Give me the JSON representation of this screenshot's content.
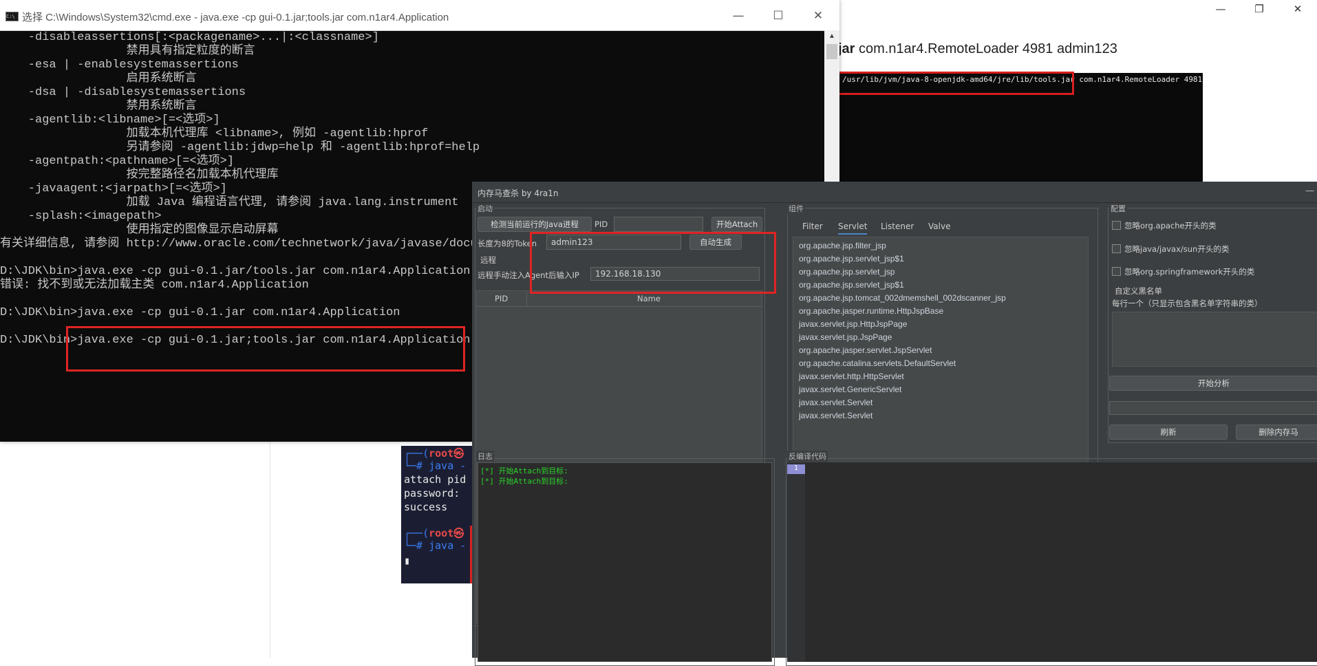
{
  "background_article": {
    "heading_bold": "jar",
    "heading_rest": " com.n1ar4.RemoteLoader 4981 admin123",
    "terminal_text": "/usr/lib/jvm/java-8-openjdk-amd64/jre/lib/tools.jar com.n1ar4.RemoteLoader 4981",
    "window_controls": [
      "—",
      "❐",
      "✕"
    ]
  },
  "kali_terminal": {
    "lines": [
      {
        "cls": "blue",
        "text": "┌──(",
        "extra": "root㉿"
      },
      {
        "cls": "blue",
        "text": "└─# java -"
      },
      {
        "cls": "white",
        "text": "attach pid"
      },
      {
        "cls": "white",
        "text": "password:"
      },
      {
        "cls": "white",
        "text": "success"
      },
      {
        "cls": "blue",
        "text": "┌──(",
        "extra": "root㉿"
      },
      {
        "cls": "blue",
        "text": "└─# java -"
      },
      {
        "cls": "white",
        "text": "▮"
      }
    ]
  },
  "cmd_window": {
    "icon_text": "C:\\",
    "title": "选择 C:\\Windows\\System32\\cmd.exe - java.exe  -cp gui-0.1.jar;tools.jar com.n1ar4.Application",
    "controls": [
      "—",
      "☐",
      "✕"
    ],
    "lines": [
      "    -disableassertions[:<packagename>...|:<classname>]",
      "                  禁用具有指定粒度的断言",
      "    -esa | -enablesystemassertions",
      "                  启用系统断言",
      "    -dsa | -disablesystemassertions",
      "                  禁用系统断言",
      "    -agentlib:<libname>[=<选项>]",
      "                  加载本机代理库 <libname>, 例如 -agentlib:hprof",
      "                  另请参阅 -agentlib:jdwp=help 和 -agentlib:hprof=help",
      "    -agentpath:<pathname>[=<选项>]",
      "                  按完整路径名加载本机代理库",
      "    -javaagent:<jarpath>[=<选项>]",
      "                  加载 Java 编程语言代理, 请参阅 java.lang.instrument",
      "    -splash:<imagepath>",
      "                  使用指定的图像显示启动屏幕",
      "有关详细信息, 请参阅 http://www.oracle.com/technetwork/java/javase/documentation/index.html。",
      "",
      "D:\\JDK\\bin>java.exe -cp gui-0.1.jar/tools.jar com.n1ar4.Application",
      "错误: 找不到或无法加载主类 com.n1ar4.Application",
      "",
      "D:\\JDK\\bin>java.exe -cp gui-0.1.jar com.n1ar4.Application",
      "",
      "D:\\JDK\\bin>java.exe -cp gui-0.1.jar;tools.jar com.n1ar4.Application"
    ]
  },
  "tool": {
    "title": "内存马查杀 by 4ra1n",
    "minimize": "—",
    "start_section": {
      "title": "启动",
      "detect_button": "检测当前运行的Java进程",
      "pid_label": "PID",
      "pid_value": "",
      "attach_button": "开始Attach",
      "token_label": "长度为8的Token",
      "token_value": "admin123",
      "auto_button": "自动生成",
      "remote_title": "远程",
      "remote_label": "远程手动注入Agent后输入IP",
      "remote_ip": "192.168.18.130"
    },
    "process_table": {
      "headers": [
        "PID",
        "Name"
      ]
    },
    "components": {
      "title": "组件",
      "tabs": [
        "Filter",
        "Servlet",
        "Listener",
        "Valve"
      ],
      "selected_tab": "Servlet",
      "classes": [
        "org.apache.jsp.filter_jsp",
        "org.apache.jsp.servlet_jsp$1",
        "org.apache.jsp.servlet_jsp",
        "org.apache.jsp.servlet_jsp$1",
        "org.apache.jsp.tomcat_002dmemshell_002dscanner_jsp",
        "org.apache.jasper.runtime.HttpJspBase",
        "javax.servlet.jsp.HttpJspPage",
        "javax.servlet.jsp.JspPage",
        "org.apache.jasper.servlet.JspServlet",
        "org.apache.catalina.servlets.DefaultServlet",
        "javax.servlet.http.HttpServlet",
        "javax.servlet.GenericServlet",
        "javax.servlet.Servlet",
        "javax.servlet.Servlet"
      ]
    },
    "config": {
      "title": "配置",
      "checkboxes": [
        "忽略org.apache开头的类",
        "忽略java/javax/sun开头的类",
        "忽略org.springframework开头的类"
      ],
      "blacklist_title": "自定义黑名单",
      "blacklist_hint": "每行一个（只显示包含黑名单字符串的类）",
      "analyze_button": "开始分析",
      "refresh_button": "刷新",
      "delete_button": "删除内存马"
    },
    "log": {
      "title": "日志",
      "lines": [
        "[*] 开始Attach到目标:",
        "[*] 开始Attach到目标:"
      ]
    },
    "decompile": {
      "title": "反编译代码",
      "line_number": "1"
    }
  }
}
